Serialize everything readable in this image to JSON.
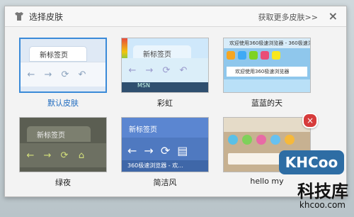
{
  "dialog": {
    "title": "选择皮肤",
    "more_link": "获取更多皮肤>>",
    "close_icon": "close-icon"
  },
  "skins": [
    {
      "name": "默认皮肤",
      "selected": true,
      "tab_text": "新标签页"
    },
    {
      "name": "彩虹",
      "selected": false,
      "tab_text": "新标签页",
      "bottom_text": "MSN"
    },
    {
      "name": "蓝蓝的天",
      "selected": false,
      "header_text": "欢迎使用360极速浏览器 - 360极速浏览器",
      "tab_text": "欢迎使用360极速浏览器"
    },
    {
      "name": "绿夜",
      "selected": false,
      "tab_text": "新标签页"
    },
    {
      "name": "简洁风",
      "selected": false,
      "tab_text": "新标签页",
      "bottom_text": "360极速浏览器 - 欢..."
    },
    {
      "name": "hello my",
      "selected": false
    }
  ],
  "watermark": {
    "logo": "KHCoo",
    "main": "科技库",
    "sub": "khcoo.com"
  },
  "colors": {
    "selected_border": "#3a8ad8",
    "selected_caption": "#1f6bbf",
    "delete_badge": "#d63b3b"
  }
}
